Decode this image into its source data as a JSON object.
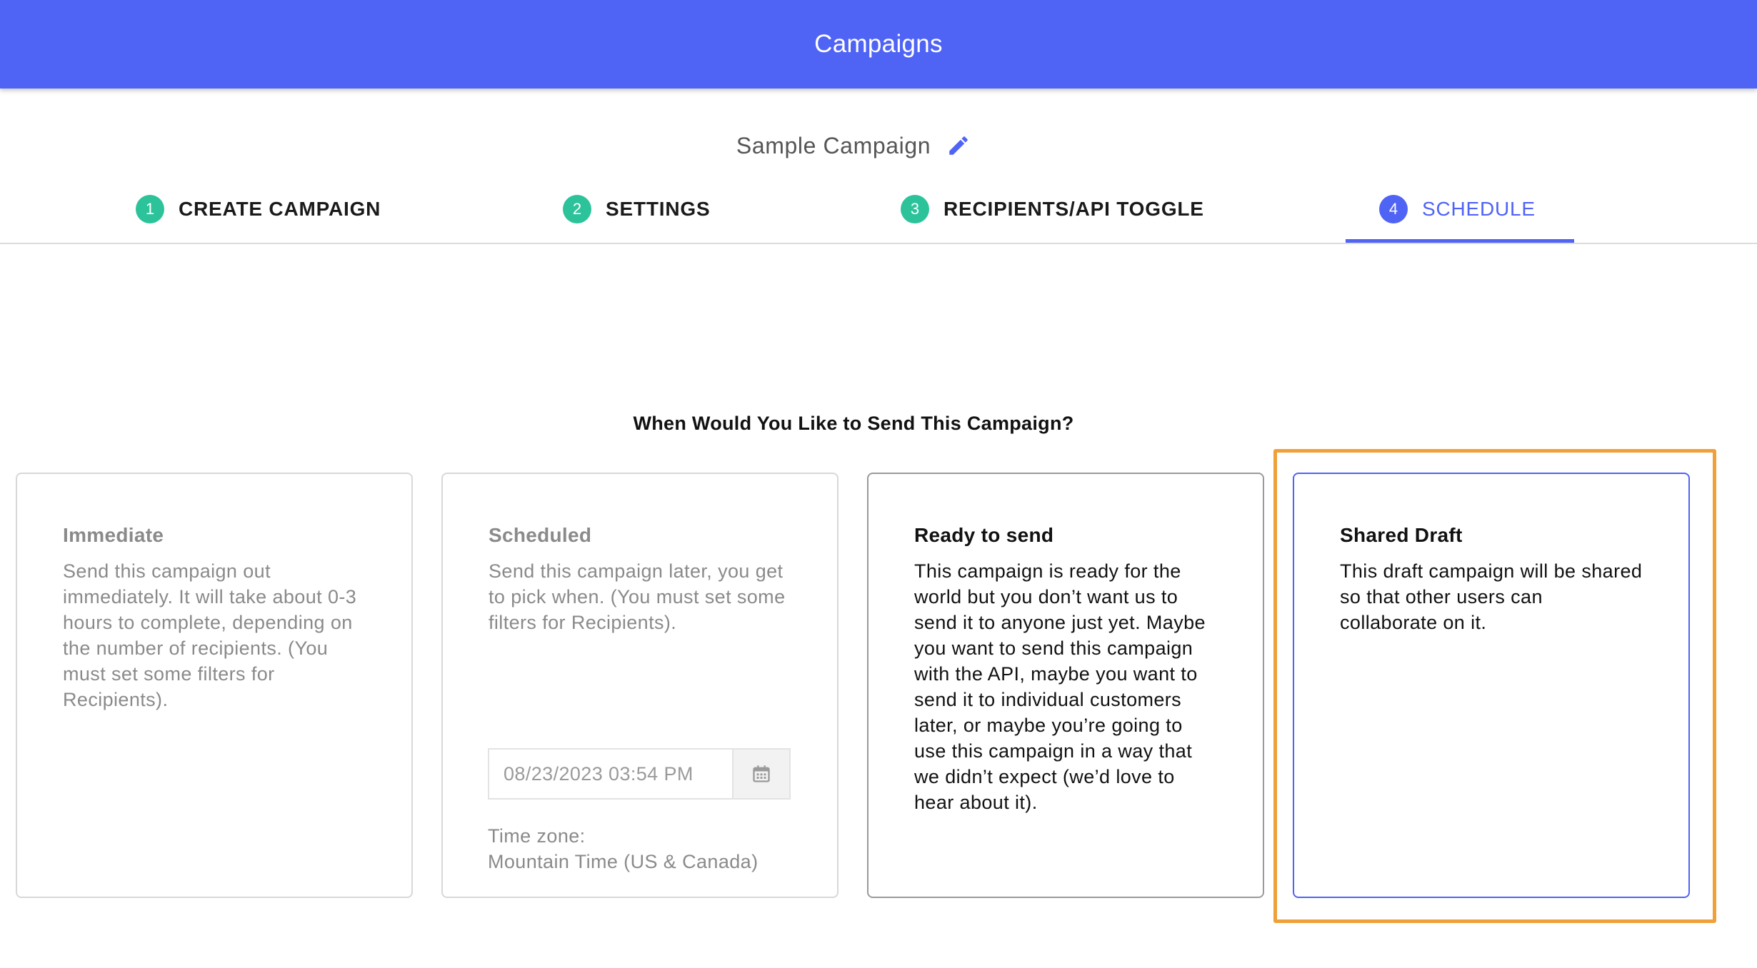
{
  "header": {
    "title": "Campaigns"
  },
  "campaign": {
    "name": "Sample Campaign"
  },
  "tabs": [
    {
      "number": "1",
      "label": "CREATE CAMPAIGN"
    },
    {
      "number": "2",
      "label": "SETTINGS"
    },
    {
      "number": "3",
      "label": "RECIPIENTS/API TOGGLE"
    },
    {
      "number": "4",
      "label": "SCHEDULE"
    }
  ],
  "question": "When Would You Like to Send This Campaign?",
  "options": {
    "immediate": {
      "title": "Immediate",
      "description": "Send this campaign out immediately. It will take about 0-3 hours to complete, depending on the number of recipients. (You must set some filters for Recipients)."
    },
    "scheduled": {
      "title": "Scheduled",
      "description": "Send this campaign later, you get to pick when. (You must set some filters for Recipients).",
      "datetime_value": "08/23/2023 03:54 PM",
      "timezone_label": "Time zone:",
      "timezone_value": "Mountain Time (US & Canada)"
    },
    "ready": {
      "title": "Ready to send",
      "description": "This campaign is ready for the world but you don’t want us to send it to anyone just yet. Maybe you want to send this campaign with the API, maybe you want to send it to individual customers later, or maybe you’re going to use this campaign in a way that we didn’t expect (we’d love to hear about it)."
    },
    "shared": {
      "title": "Shared Draft",
      "description": "This draft campaign will be shared so that other users can collaborate on it."
    }
  },
  "colors": {
    "primary": "#4f63f5",
    "step_complete": "#2cc39b",
    "highlight": "#f0a038"
  },
  "icons": {
    "edit": "pencil-icon",
    "calendar": "calendar-icon"
  }
}
